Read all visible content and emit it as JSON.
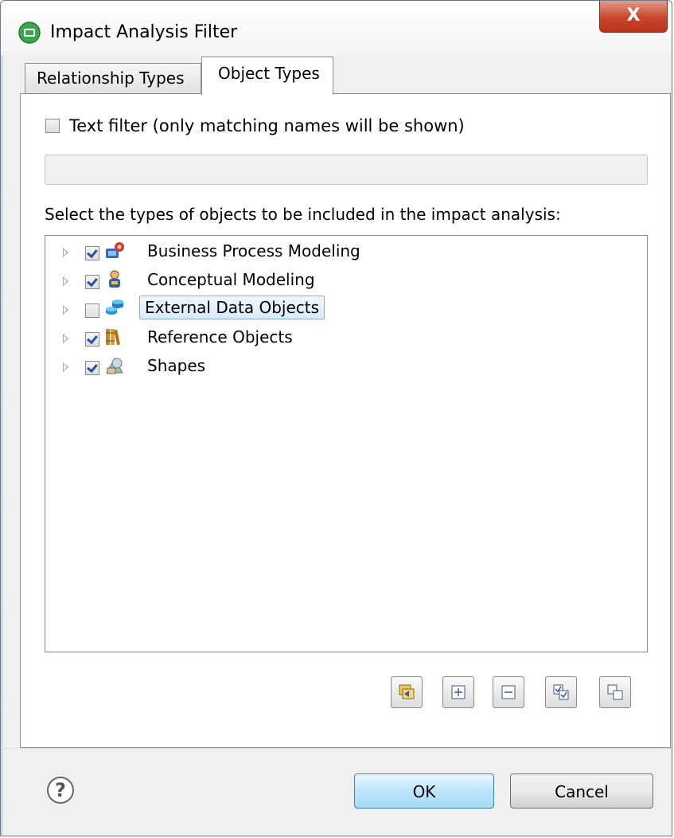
{
  "window": {
    "title": "Impact Analysis Filter",
    "close_symbol": "X"
  },
  "tabs": [
    {
      "label": "Relationship Types",
      "selected": false
    },
    {
      "label": "Object Types",
      "selected": true
    }
  ],
  "text_filter": {
    "checkbox_label": "Text filter (only matching names will be shown)",
    "checked": false,
    "value": "",
    "placeholder": ""
  },
  "tree": {
    "heading": "Select the types of objects to be included in the impact analysis:",
    "items": [
      {
        "label": "Business Process Modeling",
        "checked": true,
        "icon": "business-process-icon"
      },
      {
        "label": "Conceptual Modeling",
        "checked": true,
        "icon": "conceptual-modeling-icon"
      },
      {
        "label": "External Data Objects",
        "checked": false,
        "icon": "external-data-icon",
        "selected": true
      },
      {
        "label": "Reference Objects",
        "checked": true,
        "icon": "reference-objects-icon"
      },
      {
        "label": "Shapes",
        "checked": true,
        "icon": "shapes-icon"
      }
    ]
  },
  "toolbar": {
    "buttons": [
      "refresh-icon",
      "expand-all-icon",
      "collapse-all-icon",
      "check-all-icon",
      "uncheck-all-icon"
    ]
  },
  "footer": {
    "help_symbol": "?",
    "ok_label": "OK",
    "cancel_label": "Cancel"
  },
  "colors": {
    "accent": "#3c7fb1",
    "close_button": "#c9452c",
    "selection": "#d9eaf9"
  }
}
